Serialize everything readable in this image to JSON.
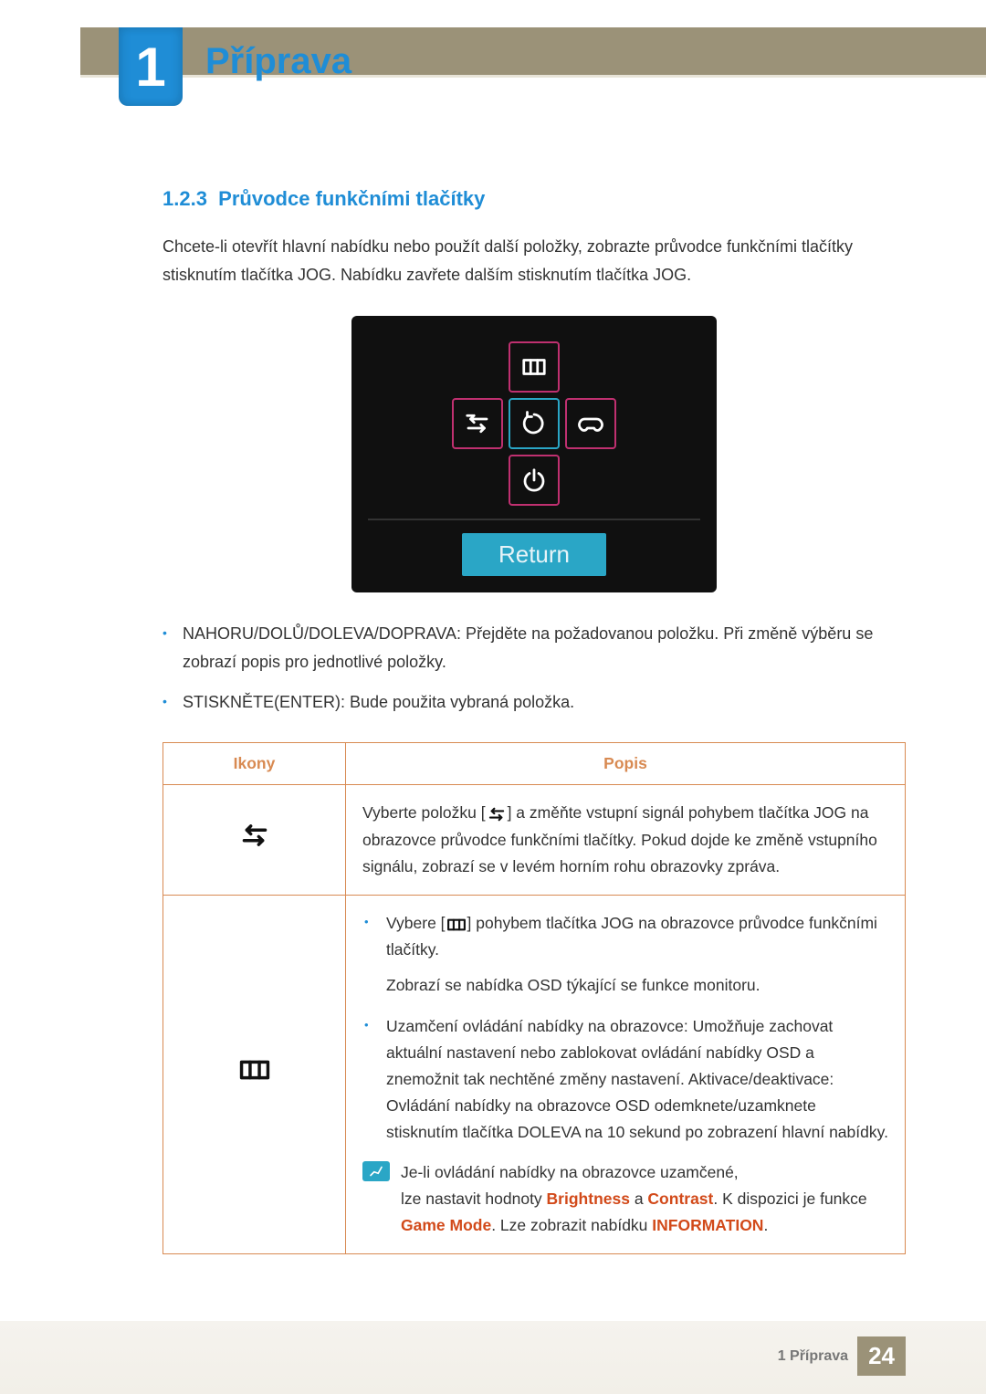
{
  "chapter": {
    "number": "1",
    "title": "Příprava"
  },
  "section": {
    "number": "1.2.3",
    "title": "Průvodce funkčními tlačítky"
  },
  "intro": "Chcete-li otevřít hlavní nabídku nebo použít další položky, zobrazte průvodce funkčními tlačítky stisknutím tlačítka JOG. Nabídku zavřete dalším stisknutím tlačítka JOG.",
  "osd": {
    "return_label": "Return"
  },
  "bullets": [
    "NAHORU/DOLŮ/DOLEVA/DOPRAVA: Přejděte na požadovanou položku. Při změně výběru se zobrazí popis pro jednotlivé položky.",
    "STISKNĚTE(ENTER): Bude použita vybraná položka."
  ],
  "table": {
    "headers": {
      "icons": "Ikony",
      "desc": "Popis"
    },
    "row1": {
      "desc_pre": "Vyberte položku [",
      "desc_post": "] a změňte vstupní signál pohybem tlačítka JOG na obrazovce průvodce funkčními tlačítky. Pokud dojde ke změně vstupního signálu, zobrazí se v levém horním rohu obrazovky zpráva."
    },
    "row2": {
      "b1_pre": "Vybere [",
      "b1_post": "] pohybem tlačítka JOG na obrazovce průvodce funkčními tlačítky.",
      "b1_line2": "Zobrazí se nabídka OSD týkající se funkce monitoru.",
      "b2": "Uzamčení ovládání nabídky na obrazovce: Umožňuje zachovat aktuální nastavení nebo zablokovat ovládání nabídky OSD a znemožnit tak nechtěné změny nastavení. Aktivace/deaktivace: Ovládání nabídky na obrazovce OSD odemknete/uzamknete stisknutím tlačítka DOLEVA na 10 sekund po zobrazení hlavní nabídky.",
      "note_l1": "Je-li ovládání nabídky na obrazovce uzamčené,",
      "note_l2a": "lze nastavit hodnoty ",
      "note_kw1": "Brightness",
      "note_mid": " a ",
      "note_kw2": "Contrast",
      "note_l2b": ". K dispozici je funkce ",
      "note_kw3": "Game Mode",
      "note_l3a": ". Lze zobrazit nabídku ",
      "note_kw4": "INFORMATION",
      "note_l3b": "."
    }
  },
  "footer": {
    "label": "1 Příprava",
    "page": "24"
  },
  "chart_data": null
}
